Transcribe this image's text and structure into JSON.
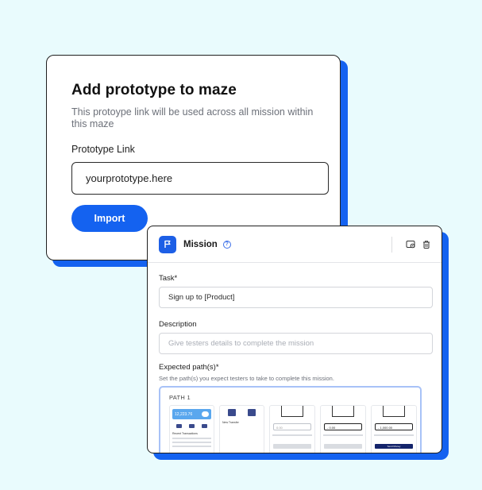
{
  "import_card": {
    "title": "Add prototype to maze",
    "description": "This protoype link will be used across all mission within this maze",
    "link_label": "Prototype Link",
    "link_value": "yourprototype.here",
    "import_button": "Import"
  },
  "mission_card": {
    "title": "Mission",
    "help_icon": "question-circle-icon",
    "actions": [
      "eye-card-icon",
      "trash-icon"
    ],
    "task_label": "Task",
    "task_value": "Sign up to [Product]",
    "description_label": "Description",
    "description_placeholder": "Give testers details to complete the mission",
    "paths_label": "Expected path(s)",
    "required_mark": "*",
    "paths_hint": "Set the path(s) you expect testers to take to complete this mission.",
    "path_name": "PATH 1",
    "screens": {
      "balance": "12,223.76",
      "recent_title": "Recent Transactions",
      "new_transfer": "New Transfer",
      "amount_1": "0.00",
      "amount_2": "- 0.00",
      "amount_3": "- 1,000.00",
      "send_money": "Send Money"
    }
  },
  "colors": {
    "background": "#e9fbfd",
    "accent": "#1462f0",
    "path_border": "#a8c2f7"
  }
}
